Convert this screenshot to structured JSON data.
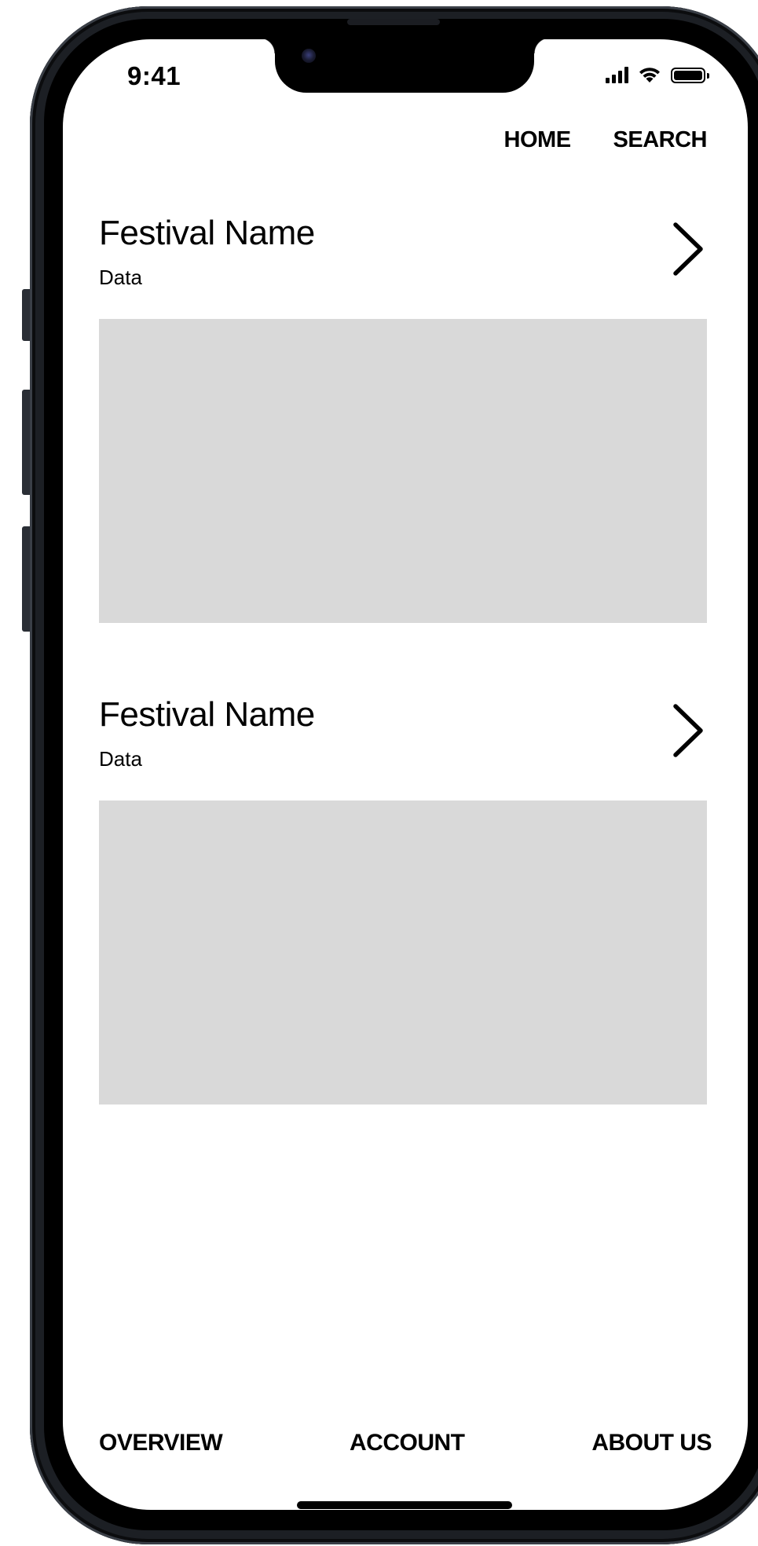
{
  "status_bar": {
    "time": "9:41",
    "icons": [
      "cellular-signal-icon",
      "wifi-icon",
      "battery-icon"
    ]
  },
  "top_nav": {
    "home_label": "HOME",
    "search_label": "SEARCH"
  },
  "festivals": [
    {
      "title": "Festival Name",
      "subtitle": "Data",
      "arrow_icon": "chevron-right-icon",
      "image_placeholder_color": "#D9D9D9"
    },
    {
      "title": "Festival Name",
      "subtitle": "Data",
      "arrow_icon": "chevron-right-icon",
      "image_placeholder_color": "#D9D9D9"
    }
  ],
  "bottom_nav": {
    "overview_label": "OVERVIEW",
    "account_label": "ACCOUNT",
    "about_label": "ABOUT US"
  },
  "colors": {
    "background": "#FFFFFF",
    "text": "#000000",
    "placeholder": "#D9D9D9",
    "device_frame": "#1C1F24"
  }
}
